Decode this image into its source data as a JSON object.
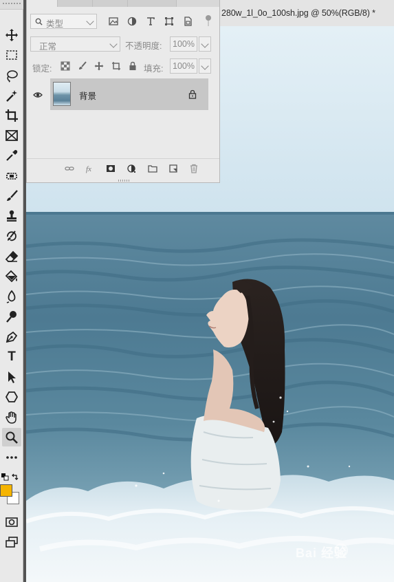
{
  "document": {
    "title": "280w_1l_0o_100sh.jpg @ 50%(RGB/8) *"
  },
  "toolbar": {
    "tools": [
      {
        "name": "move-tool",
        "icon": "move-icon"
      },
      {
        "name": "marquee-tool",
        "icon": "rectangle-marquee-icon"
      },
      {
        "name": "lasso-tool",
        "icon": "lasso-icon"
      },
      {
        "name": "magic-wand-tool",
        "icon": "magic-wand-icon"
      },
      {
        "name": "crop-tool",
        "icon": "crop-icon"
      },
      {
        "name": "frame-tool",
        "icon": "frame-icon"
      },
      {
        "name": "eyedropper-tool",
        "icon": "eyedropper-icon"
      },
      {
        "name": "healing-brush-tool",
        "icon": "healing-icon"
      },
      {
        "name": "brush-tool",
        "icon": "brush-icon"
      },
      {
        "name": "stamp-tool",
        "icon": "stamp-icon"
      },
      {
        "name": "history-brush-tool",
        "icon": "history-brush-icon"
      },
      {
        "name": "eraser-tool",
        "icon": "eraser-icon"
      },
      {
        "name": "paint-bucket-tool",
        "icon": "paint-bucket-icon"
      },
      {
        "name": "blur-tool",
        "icon": "blur-icon"
      },
      {
        "name": "dodge-tool",
        "icon": "dodge-icon"
      },
      {
        "name": "pen-tool",
        "icon": "pen-icon"
      },
      {
        "name": "type-tool",
        "icon": "type-icon",
        "text": "T"
      },
      {
        "name": "path-selection-tool",
        "icon": "arrow-icon"
      },
      {
        "name": "shape-tool",
        "icon": "hexagon-icon"
      },
      {
        "name": "hand-tool",
        "icon": "hand-icon"
      },
      {
        "name": "zoom-tool",
        "icon": "zoom-icon"
      },
      {
        "name": "more-tools",
        "icon": "ellipsis-icon"
      }
    ],
    "foreground_color": "#f5b400",
    "background_color": "#ffffff"
  },
  "layers_panel": {
    "filter_kind": "类型",
    "blend_mode": "正常",
    "opacity_label": "不透明度:",
    "opacity_value": "100%",
    "lock_label": "锁定:",
    "fill_label": "填充:",
    "fill_value": "100%",
    "layers": [
      {
        "name": "背景",
        "visible": true,
        "locked": true
      }
    ]
  },
  "watermark": {
    "text": "Bai 经验"
  },
  "colors": {
    "panel_bg": "#eaeaea",
    "selected_layer": "#c7c7c7",
    "sea_dark": "#4d7a92",
    "sky": "#e4f0f6"
  }
}
